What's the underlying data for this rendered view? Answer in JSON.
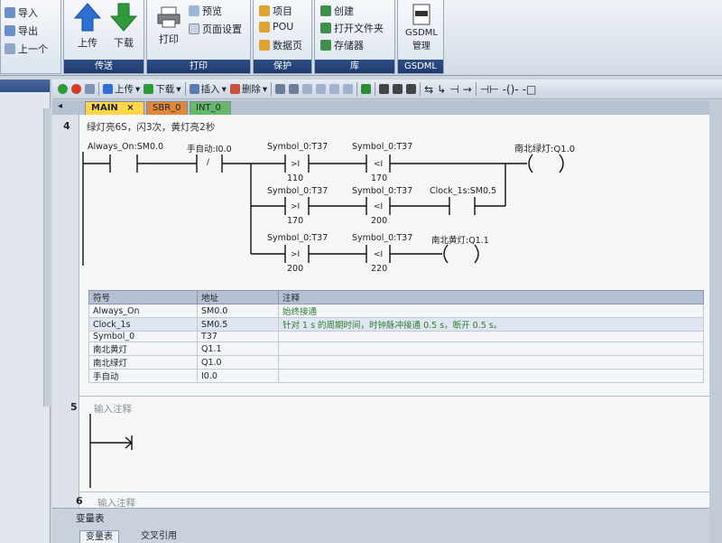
{
  "ribbon": {
    "groups": [
      {
        "items": [
          "导入",
          "导出",
          "上一个"
        ]
      },
      {
        "label": "传送",
        "items": [
          "上传",
          "下载"
        ]
      },
      {
        "label": "打印",
        "items": [
          "打印",
          "预览",
          "页面设置"
        ]
      },
      {
        "label": "保护",
        "items": [
          "项目",
          "POU",
          "数据页"
        ]
      },
      {
        "label": "库",
        "items": [
          "创建",
          "打开文件夹",
          "存储器"
        ]
      },
      {
        "label": "GSDML",
        "items": [
          "GSDML",
          "管理"
        ]
      }
    ]
  },
  "toolbar": {
    "upload": "上传",
    "download": "下载",
    "insert": "插入",
    "delete": "删除"
  },
  "tabs": [
    {
      "label": "MAIN",
      "close": "×"
    },
    {
      "label": "SBR_0"
    },
    {
      "label": "INT_0"
    }
  ],
  "network4": {
    "number": "4",
    "comment": "绿灯亮6S，闪3次，黄灯亮2秒",
    "contacts": {
      "always_on": "Always_On:SM0.0",
      "manual": "手自动:I0.0",
      "r1_t37a": "Symbol_0:T37",
      "r1_t37b": "Symbol_0:T37",
      "r1_val_a": "110",
      "r1_val_b": "170",
      "r2_t37a": "Symbol_0:T37",
      "r2_t37b": "Symbol_0:T37",
      "r2_val_a": "170",
      "r2_val_b": "200",
      "clock": "Clock_1s:SM0.5",
      "r3_t37a": "Symbol_0:T37",
      "r3_t37b": "Symbol_0:T37",
      "r3_val_a": "200",
      "r3_val_b": "220",
      "op_ge": ">I",
      "op_lt": "<I",
      "op_not": "/"
    },
    "coils": {
      "green": "南北绿灯:Q1.0",
      "yellow": "南北黄灯:Q1.1"
    }
  },
  "symbol_table": {
    "headers": [
      "符号",
      "地址",
      "注释"
    ],
    "rows": [
      [
        "Always_On",
        "SM0.0",
        "始终接通"
      ],
      [
        "Clock_1s",
        "SM0.5",
        "针对 1 s 的周期时间，时钟脉冲接通 0.5 s，断开 0.5 s。"
      ],
      [
        "Symbol_0",
        "T37",
        ""
      ],
      [
        "南北黄灯",
        "Q1.1",
        ""
      ],
      [
        "南北绿灯",
        "Q1.0",
        ""
      ],
      [
        "手自动",
        "I0.0",
        ""
      ]
    ]
  },
  "network5": {
    "number": "5",
    "comment": "输入注释"
  },
  "network6": {
    "number": "6",
    "comment": "输入注释"
  },
  "bottom": {
    "title": "变量表",
    "tabs": [
      "变量表",
      "交叉引用"
    ]
  },
  "colors": {
    "accent": "#2f4f85",
    "tab_main": "#ffd54a",
    "tab_sbr": "#e0873a",
    "tab_int": "#67b96a",
    "comment_green": "#2e7d2e"
  }
}
